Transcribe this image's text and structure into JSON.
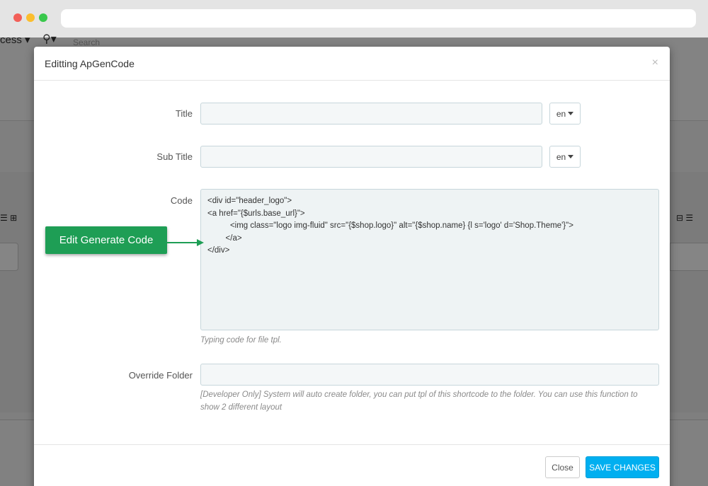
{
  "background_app": {
    "access_label": "cess",
    "search_placeholder": "Search"
  },
  "modal": {
    "title": "Editting ApGenCode",
    "close_glyph": "×",
    "fields": {
      "title": {
        "label": "Title",
        "value": "",
        "lang": "en"
      },
      "subtitle": {
        "label": "Sub Title",
        "value": "",
        "lang": "en"
      },
      "code": {
        "label": "Code",
        "lines": [
          "<div id=\"header_logo\">",
          "<a href=\"{$urls.base_url}\">",
          "          <img class=\"logo img-fluid\" src=\"{$shop.logo}\" alt=\"{$shop.name} {l s='logo' d='Shop.Theme'}\">",
          "        </a>",
          "</div>"
        ],
        "help": "Typing code for file tpl."
      },
      "override_folder": {
        "label": "Override Folder",
        "value": "",
        "help": "[Developer Only] System will auto create folder, you can put tpl of this shortcode to the folder. You can use this function to show 2 different layout"
      }
    },
    "footer": {
      "close_label": "Close",
      "save_label": "SAVE CHANGES"
    }
  },
  "annotation": {
    "label": "Edit Generate Code"
  },
  "colors": {
    "accent": "#00aff0",
    "callout": "#1e9e55",
    "field_bg": "#f4f7f8",
    "field_border": "#c7d6db"
  }
}
